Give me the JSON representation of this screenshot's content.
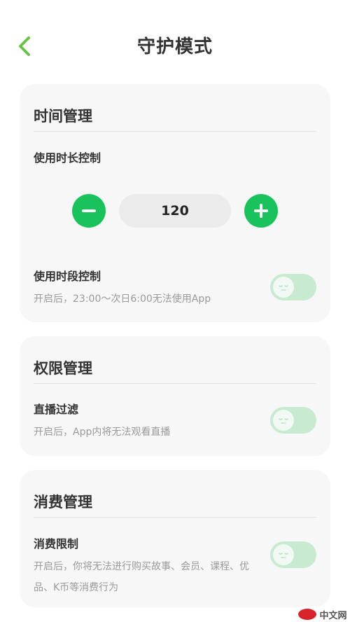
{
  "header": {
    "title": "守护模式",
    "back_icon": "chevron-left-icon"
  },
  "colors": {
    "accent": "#19c25a",
    "toggle_off": "#c7ead0",
    "card_bg": "#f7f7f7"
  },
  "time_section": {
    "title": "时间管理",
    "duration_label": "使用时长控制",
    "duration_value": "120",
    "period_label": "使用时段控制",
    "period_desc": "开启后，23:00～次日6:00无法使用App"
  },
  "permission_section": {
    "title": "权限管理",
    "live_label": "直播过滤",
    "live_desc": "开启后，App内将无法观看直播"
  },
  "spending_section": {
    "title": "消费管理",
    "limit_label": "消费限制",
    "limit_desc": "开启后，你将无法进行购买故事、会员、课程、优品、K币等消费行为"
  },
  "watermark": {
    "text": "中文网"
  }
}
